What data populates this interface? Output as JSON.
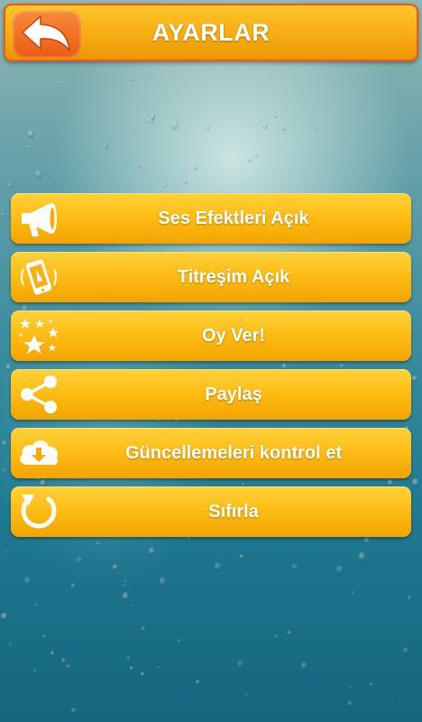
{
  "header": {
    "title": "AYARLAR",
    "back_icon": "back-arrow-icon"
  },
  "menu": {
    "items": [
      {
        "label": "Ses Efektleri Açık",
        "icon": "megaphone-icon"
      },
      {
        "label": "Titreşim Açık",
        "icon": "phone-vibrate-icon"
      },
      {
        "label": "Oy Ver!",
        "icon": "stars-icon"
      },
      {
        "label": "Paylaş",
        "icon": "share-icon"
      },
      {
        "label": "Güncellemeleri kontrol et",
        "icon": "cloud-download-icon"
      },
      {
        "label": "Sıfırla",
        "icon": "reset-icon"
      }
    ]
  },
  "colors": {
    "button_fill": "#fdbb14",
    "header_border": "#ef5a12",
    "back_button": "#ea5b12",
    "text": "#ffffff"
  }
}
